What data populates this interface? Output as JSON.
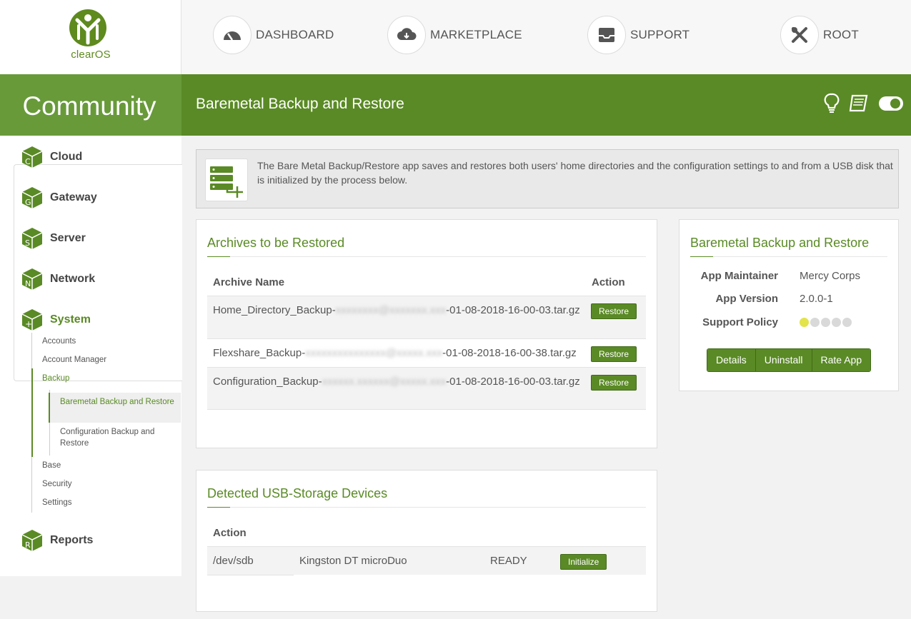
{
  "brand": {
    "logo_text": "clearOS",
    "edition": "Community"
  },
  "topnav": [
    {
      "label": "DASHBOARD",
      "icon": "dashboard-gauge-icon"
    },
    {
      "label": "MARKETPLACE",
      "icon": "cloud-download-icon"
    },
    {
      "label": "SUPPORT",
      "icon": "inbox-tray-icon"
    },
    {
      "label": "ROOT",
      "icon": "tools-icon"
    }
  ],
  "header": {
    "title": "Baremetal Backup and Restore",
    "icons": [
      "lightbulb-icon",
      "book-icon",
      "toggle-icon"
    ]
  },
  "sidebar": {
    "categories": [
      {
        "label": "Cloud",
        "letter": "C"
      },
      {
        "label": "Gateway",
        "letter": "G"
      },
      {
        "label": "Server",
        "letter": "S"
      },
      {
        "label": "Network",
        "letter": "N"
      },
      {
        "label": "System",
        "letter": "+"
      },
      {
        "label": "Reports",
        "letter": "R"
      }
    ],
    "system_items": [
      "Accounts",
      "Account Manager",
      "Backup",
      "Base",
      "Security",
      "Settings"
    ],
    "backup_items": [
      "Baremetal Backup and Restore",
      "Configuration Backup and Restore"
    ]
  },
  "intro": {
    "text": "The Bare Metal Backup/Restore app saves and restores both users' home directories and the configuration settings to and from a USB disk that is initialized by the process below."
  },
  "archives": {
    "title": "Archives to be Restored",
    "columns": [
      "Archive Name",
      "Action"
    ],
    "rows": [
      {
        "prefix": "Home_Directory_Backup-",
        "redacted": "xxxxxxxx@xxxxxxx.xxx",
        "suffix": "-01-08-2018-16-00-03.tar.gz",
        "action": "Restore"
      },
      {
        "prefix": "Flexshare_Backup-",
        "redacted": "xxxxxxxxxxxxxxx@xxxxx.xxx",
        "suffix": "-01-08-2018-16-00-38.tar.gz",
        "action": "Restore"
      },
      {
        "prefix": "Configuration_Backup-",
        "redacted": "xxxxxx.xxxxxx@xxxxx.xxx",
        "suffix": "-01-08-2018-16-00-03.tar.gz",
        "action": "Restore"
      }
    ]
  },
  "devices": {
    "title": "Detected USB-Storage Devices",
    "columns": [
      "Action"
    ],
    "rows": [
      {
        "device": "/dev/sdb",
        "model": "Kingston DT microDuo",
        "status": "READY",
        "action": "Initialize"
      }
    ]
  },
  "app_info": {
    "title": "Baremetal Backup and Restore",
    "maintainer_label": "App Maintainer",
    "maintainer": "Mercy Corps",
    "version_label": "App Version",
    "version": "2.0.0-1",
    "support_label": "Support Policy",
    "support_level": 1,
    "support_max": 5,
    "buttons": [
      "Details",
      "Uninstall",
      "Rate App"
    ]
  },
  "colors": {
    "brand_green": "#5a8a25",
    "band_light": "#689a3a",
    "support_dot": "#e3e34a"
  }
}
